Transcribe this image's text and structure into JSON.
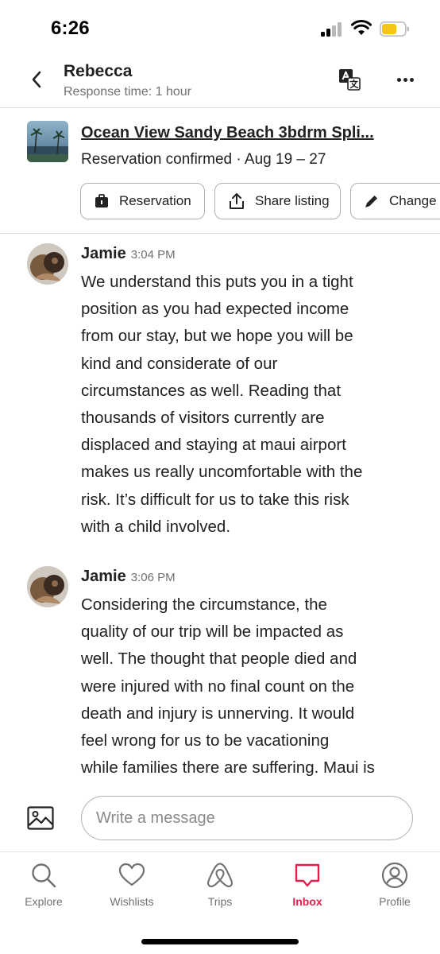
{
  "status_bar": {
    "time": "6:26"
  },
  "header": {
    "host_name": "Rebecca",
    "response_time": "Response time: 1 hour",
    "icons": [
      "chevron-left-icon",
      "translate-icon",
      "more-icon"
    ]
  },
  "listing": {
    "title": "Ocean View Sandy Beach 3bdrm Spli...",
    "status": "Reservation confirmed · Aug 19 – 27",
    "actions": [
      {
        "label": "Reservation",
        "icon": "suitcase-icon"
      },
      {
        "label": "Share listing",
        "icon": "share-icon"
      },
      {
        "label": "Change",
        "icon": "pencil-icon"
      }
    ]
  },
  "messages": [
    {
      "sender": "Jamie",
      "time": "3:04 PM",
      "lines": [
        "We understand this puts you in a tight",
        "position as you had expected income",
        "from our stay, but we hope you will be",
        "kind and considerate of our",
        "circumstances as well. Reading that",
        "thousands of visitors currently are",
        "displaced and staying at maui airport",
        "makes us really uncomfortable with the",
        "risk. It’s difficult for us to take this risk",
        "with a child involved."
      ]
    },
    {
      "sender": "Jamie",
      "time": "3:06 PM",
      "lines": [
        "Considering the circumstance, the",
        "quality of our trip will be impacted as",
        "well. The thought that people died and",
        "were injured with no final count on the",
        "death and injury is unnerving. It would",
        "feel wrong for us to be vacationing",
        "while families there are suffering. Maui is"
      ]
    }
  ],
  "composer": {
    "placeholder": "Write a message",
    "value": ""
  },
  "tabs": [
    {
      "label": "Explore",
      "icon": "search-icon",
      "active": false
    },
    {
      "label": "Wishlists",
      "icon": "heart-icon",
      "active": false
    },
    {
      "label": "Trips",
      "icon": "airbnb-logo-icon",
      "active": false
    },
    {
      "label": "Inbox",
      "icon": "message-icon",
      "active": true
    },
    {
      "label": "Profile",
      "icon": "profile-icon",
      "active": false
    }
  ],
  "colors": {
    "accent": "#e61e4d",
    "text": "#222222",
    "muted": "#717171",
    "border": "#b0b0b0"
  }
}
